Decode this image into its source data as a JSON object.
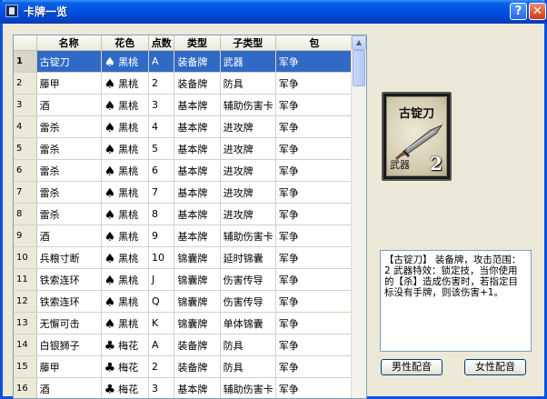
{
  "window": {
    "title": "卡牌一览"
  },
  "titlebar_buttons": {
    "help": "?",
    "close": "✕"
  },
  "columns": [
    "",
    "名称",
    "花色",
    "点数",
    "类型",
    "子类型",
    "包"
  ],
  "rows": [
    {
      "idx": "1",
      "name": "古锭刀",
      "suit_icon": "♠",
      "suit": "黑桃",
      "point": "A",
      "type": "装备牌",
      "subtype": "武器",
      "pack": "军争",
      "selected": true
    },
    {
      "idx": "2",
      "name": "藤甲",
      "suit_icon": "♠",
      "suit": "黑桃",
      "point": "2",
      "type": "装备牌",
      "subtype": "防具",
      "pack": "军争"
    },
    {
      "idx": "3",
      "name": "酒",
      "suit_icon": "♠",
      "suit": "黑桃",
      "point": "3",
      "type": "基本牌",
      "subtype": "辅助伤害卡",
      "pack": "军争"
    },
    {
      "idx": "4",
      "name": "雷杀",
      "suit_icon": "♠",
      "suit": "黑桃",
      "point": "4",
      "type": "基本牌",
      "subtype": "进攻牌",
      "pack": "军争"
    },
    {
      "idx": "5",
      "name": "雷杀",
      "suit_icon": "♠",
      "suit": "黑桃",
      "point": "5",
      "type": "基本牌",
      "subtype": "进攻牌",
      "pack": "军争"
    },
    {
      "idx": "6",
      "name": "雷杀",
      "suit_icon": "♠",
      "suit": "黑桃",
      "point": "6",
      "type": "基本牌",
      "subtype": "进攻牌",
      "pack": "军争"
    },
    {
      "idx": "7",
      "name": "雷杀",
      "suit_icon": "♠",
      "suit": "黑桃",
      "point": "7",
      "type": "基本牌",
      "subtype": "进攻牌",
      "pack": "军争"
    },
    {
      "idx": "8",
      "name": "雷杀",
      "suit_icon": "♠",
      "suit": "黑桃",
      "point": "8",
      "type": "基本牌",
      "subtype": "进攻牌",
      "pack": "军争"
    },
    {
      "idx": "9",
      "name": "酒",
      "suit_icon": "♠",
      "suit": "黑桃",
      "point": "9",
      "type": "基本牌",
      "subtype": "辅助伤害卡",
      "pack": "军争"
    },
    {
      "idx": "10",
      "name": "兵粮寸断",
      "suit_icon": "♠",
      "suit": "黑桃",
      "point": "10",
      "type": "锦囊牌",
      "subtype": "延时锦囊",
      "pack": "军争"
    },
    {
      "idx": "11",
      "name": "铁索连环",
      "suit_icon": "♠",
      "suit": "黑桃",
      "point": "J",
      "type": "锦囊牌",
      "subtype": "伤害传导",
      "pack": "军争"
    },
    {
      "idx": "12",
      "name": "铁索连环",
      "suit_icon": "♠",
      "suit": "黑桃",
      "point": "Q",
      "type": "锦囊牌",
      "subtype": "伤害传导",
      "pack": "军争"
    },
    {
      "idx": "13",
      "name": "无懈可击",
      "suit_icon": "♠",
      "suit": "黑桃",
      "point": "K",
      "type": "锦囊牌",
      "subtype": "单体锦囊",
      "pack": "军争"
    },
    {
      "idx": "14",
      "name": "白银狮子",
      "suit_icon": "♣",
      "suit": "梅花",
      "point": "A",
      "type": "装备牌",
      "subtype": "防具",
      "pack": "军争"
    },
    {
      "idx": "15",
      "name": "藤甲",
      "suit_icon": "♣",
      "suit": "梅花",
      "point": "2",
      "type": "装备牌",
      "subtype": "防具",
      "pack": "军争"
    },
    {
      "idx": "16",
      "name": "酒",
      "suit_icon": "♣",
      "suit": "梅花",
      "point": "3",
      "type": "基本牌",
      "subtype": "辅助伤害卡",
      "pack": "军争"
    }
  ],
  "card": {
    "name": "古锭刀",
    "subtype": "武器",
    "point": "2"
  },
  "description": "【古锭刀】 装备牌，攻击范围：2 武器特效：锁定技，当你使用的【杀】造成伤害时，若指定目标没有手牌，则该伤害+1。",
  "buttons": {
    "male_voice": "男性配音",
    "female_voice": "女性配音"
  }
}
